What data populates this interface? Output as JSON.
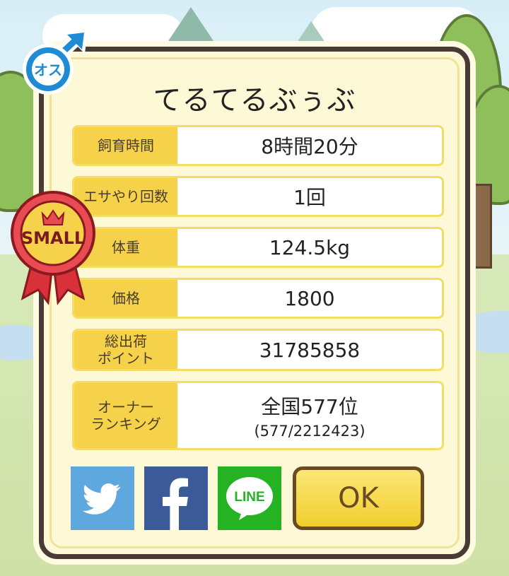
{
  "dialog": {
    "title": "てるてるぶぅぶ",
    "gender_badge": "オス",
    "size_badge": "SMALL",
    "stats": [
      {
        "label": "飼育時間",
        "value": "8時間20分"
      },
      {
        "label": "エサやり回数",
        "value": "1回"
      },
      {
        "label": "体重",
        "value": "124.5kg"
      },
      {
        "label": "価格",
        "value": "1800"
      },
      {
        "label": "総出荷\nポイント",
        "value": "31785858"
      },
      {
        "label": "オーナー\nランキング",
        "value": "全国577位",
        "sub": "(577/2212423)"
      }
    ],
    "share": {
      "twitter_icon": "twitter-bird-icon",
      "facebook_icon": "facebook-f-icon",
      "line_label": "LINE"
    },
    "ok_label": "OK"
  },
  "colors": {
    "panel_bg": "#fdf8d6",
    "label_bg": "#f6d24a",
    "border": "#4a3a36",
    "twitter": "#5fa8df",
    "facebook": "#3d5a98",
    "line": "#25b324",
    "ok_button": "#f2cd2c"
  }
}
